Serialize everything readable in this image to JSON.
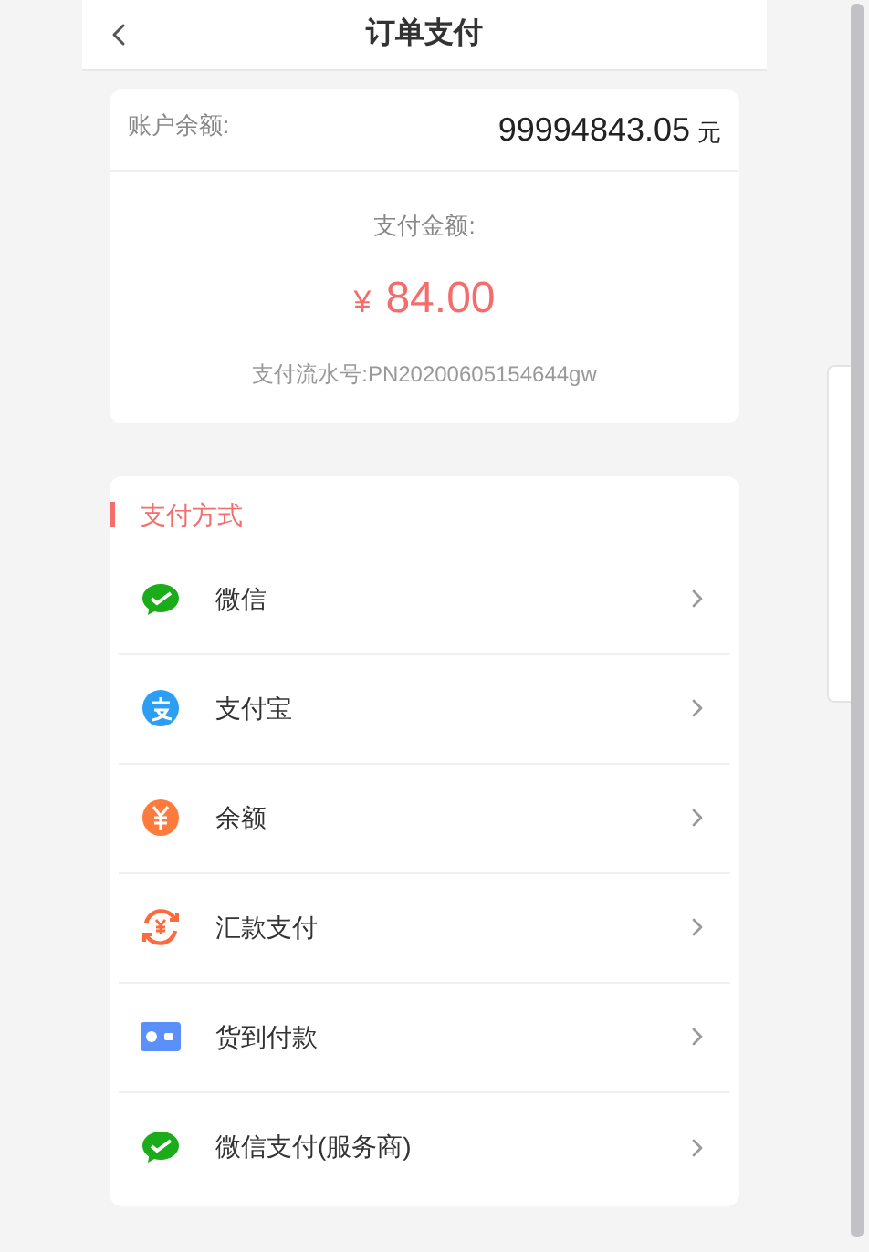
{
  "header": {
    "title": "订单支付"
  },
  "summary": {
    "balance_label": "账户余额:",
    "balance_value": "99994843.05",
    "balance_unit": "元",
    "amount_label": "支付金额:",
    "currency": "¥",
    "amount": "84.00",
    "serial": "支付流水号:PN20200605154644gw"
  },
  "payment": {
    "title": "支付方式",
    "methods": [
      {
        "kind": "wechat",
        "label": "微信"
      },
      {
        "kind": "alipay",
        "label": "支付宝"
      },
      {
        "kind": "balance",
        "label": "余额"
      },
      {
        "kind": "remit",
        "label": "汇款支付"
      },
      {
        "kind": "cod",
        "label": "货到付款"
      },
      {
        "kind": "wechat",
        "label": "微信支付(服务商)"
      }
    ]
  }
}
